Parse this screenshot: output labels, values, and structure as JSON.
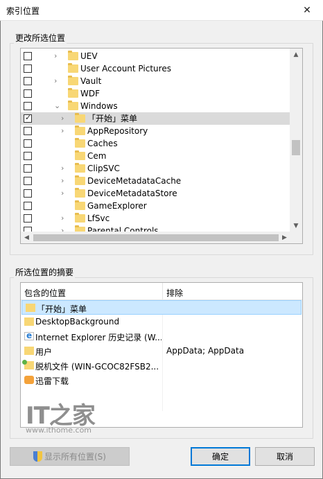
{
  "window": {
    "title": "索引位置",
    "close_glyph": "✕"
  },
  "tree_group": {
    "label": "更改所选位置"
  },
  "tree_items": [
    {
      "label": "UEV",
      "checked": false,
      "expander": ">"
    },
    {
      "label": "User Account Pictures",
      "checked": false,
      "expander": ""
    },
    {
      "label": "Vault",
      "checked": false,
      "expander": ">"
    },
    {
      "label": "WDF",
      "checked": false,
      "expander": ""
    },
    {
      "label": "Windows",
      "checked": false,
      "expander": "v"
    },
    {
      "label": "「开始」菜单",
      "checked": true,
      "expander": ">"
    },
    {
      "label": "AppRepository",
      "checked": false,
      "expander": ">"
    },
    {
      "label": "Caches",
      "checked": false,
      "expander": ""
    },
    {
      "label": "Cem",
      "checked": false,
      "expander": ""
    },
    {
      "label": "ClipSVC",
      "checked": false,
      "expander": ">"
    },
    {
      "label": "DeviceMetadataCache",
      "checked": false,
      "expander": ">"
    },
    {
      "label": "DeviceMetadataStore",
      "checked": false,
      "expander": ">"
    },
    {
      "label": "GameExplorer",
      "checked": false,
      "expander": ""
    },
    {
      "label": "LfSvc",
      "checked": false,
      "expander": ">"
    },
    {
      "label": "Parental Controls",
      "checked": false,
      "expander": ">"
    }
  ],
  "summary_group": {
    "label": "所选位置的摘要"
  },
  "summary": {
    "col_included": "包含的位置",
    "col_excluded": "排除",
    "rows": [
      {
        "location": "「开始」菜单",
        "exclude": "",
        "icon": "folder-icon"
      },
      {
        "location": "DesktopBackground",
        "exclude": "",
        "icon": "folder-icon"
      },
      {
        "location": "Internet Explorer 历史记录 (W...",
        "exclude": "",
        "icon": "internet-explorer-icon"
      },
      {
        "location": "用户",
        "exclude": "AppData; AppData",
        "icon": "folder-icon"
      },
      {
        "location": "脱机文件 (WIN-GCOC82FSB2...",
        "exclude": "",
        "icon": "offline-files-icon"
      },
      {
        "location": "迅雷下载",
        "exclude": "",
        "icon": "xunlei-icon"
      }
    ]
  },
  "watermark": {
    "logo": "IT之家",
    "url": "www.ithome.com"
  },
  "buttons": {
    "show_all": "显示所有位置(S)",
    "ok": "确定",
    "cancel": "取消"
  },
  "colors": {
    "accent": "#0078d7",
    "folder": "#f8d775",
    "selection": "#cce8ff",
    "tree_selection": "#dadada"
  }
}
